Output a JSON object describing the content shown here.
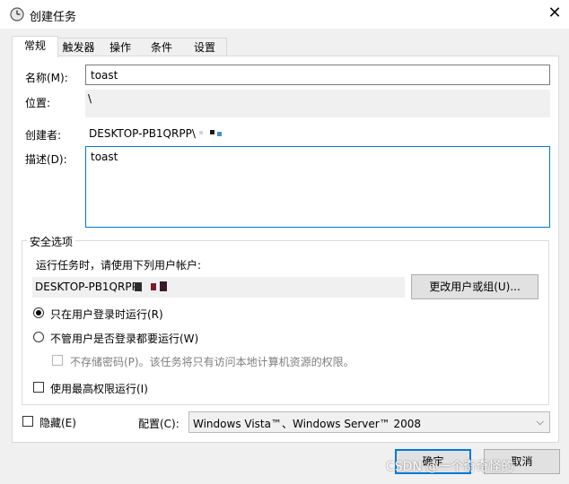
{
  "window": {
    "title": "创建任务",
    "close": "✕"
  },
  "tabs": [
    "常规",
    "触发器",
    "操作",
    "条件",
    "设置"
  ],
  "general": {
    "name_label": "名称(M):",
    "name_value": "toast",
    "location_label": "位置:",
    "location_value": "\\",
    "author_label": "创建者:",
    "author_value": "DESKTOP-PB1QRPP\\",
    "description_label": "描述(D):",
    "description_value": "toast"
  },
  "security": {
    "group_title": "安全选项",
    "run_as_prompt": "运行任务时，请使用下列用户帐户:",
    "run_as_account": "DESKTOP-PB1QRPP\\",
    "change_user_button": "更改用户或组(U)...",
    "radio_logged_on": "只在用户登录时运行(R)",
    "radio_logged_on_checked": true,
    "radio_any": "不管用户是否登录都要运行(W)",
    "radio_any_checked": false,
    "no_store_password": "不存储密码(P)。该任务将只有访问本地计算机资源的权限。",
    "highest_privileges": "使用最高权限运行(I)"
  },
  "bottom": {
    "hidden_label": "隐藏(E)",
    "configure_label": "配置(C):",
    "configure_value": "Windows Vista™、Windows Server™ 2008"
  },
  "buttons": {
    "ok": "确定",
    "cancel": "取消"
  },
  "watermark": "CSDN @一个奇奇怪的",
  "colors": {
    "accent": "#0078d7",
    "window_bg": "#f0f0f0",
    "panel_bg": "#ffffff"
  }
}
